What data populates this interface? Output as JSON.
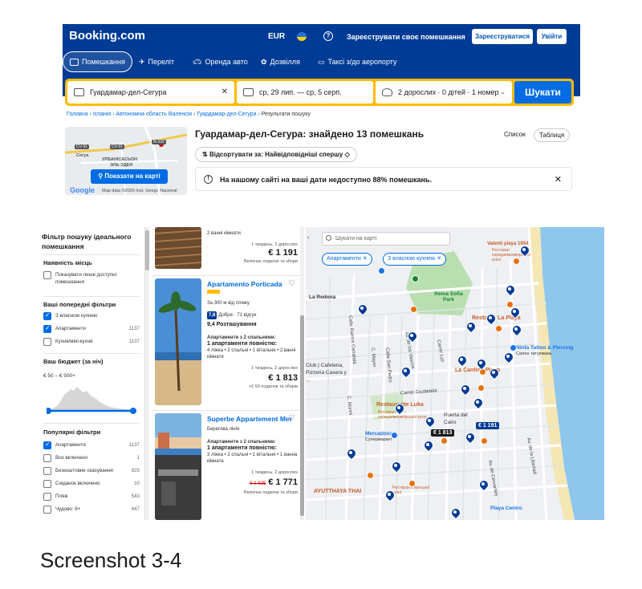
{
  "header": {
    "logo": "Booking.com",
    "currency": "EUR",
    "list_property": "Зареєструвати своє помешкання",
    "register": "Зареєструватися",
    "signin": "Увійти",
    "nav": [
      "Помешкання",
      "Переліт",
      "Оренда авто",
      "Дозвілля",
      "Таксі з/до аеропорту"
    ]
  },
  "search": {
    "destination": "Гуардамар-дел-Сегура",
    "dates": "ср, 29 лип. — ср, 5 серп.",
    "guests": "2 дорослих · 0 дітей · 1 номер",
    "submit": "Шукати"
  },
  "breadcrumb": [
    "Головна",
    "Іспанія",
    "Автономна область Валенсія",
    "Гуардамар-дел-Сегура",
    "Результати пошуку"
  ],
  "minimap": {
    "show_map": "Показати на карті",
    "google": "Google",
    "credit": "Map data ©2026 Inst. Geogr. Nacional",
    "labels": [
      "Cerya",
      "УРБАНІСАСЬОН",
      "ЭЛЬ ЭДЕН"
    ],
    "badges": [
      "CV-91",
      "CV-91",
      "N-332"
    ]
  },
  "results": {
    "title": "Гуардамар-дел-Сегура: знайдено 13 помешкань",
    "sort": "Відсортувати за: Найвідповідніші спершу",
    "view_list": "Список",
    "view_table": "Таблиця",
    "notice": "На нашому сайті на ваші дати недоступно 88% помешкань."
  },
  "filters": {
    "heading": "Фільтр пошуку ідеального помешкання",
    "availability_title": "Наявність місць",
    "availability_item": "Показувати лише доступні помешкання",
    "previous_title": "Ваші попередні фільтри",
    "previous": [
      {
        "label": "З власною кухнею",
        "count": "",
        "checked": true
      },
      {
        "label": "Апартаменти",
        "count": "1137",
        "checked": true
      },
      {
        "label": "Кухня/міні-кухня",
        "count": "1137",
        "checked": false
      }
    ],
    "budget_title": "Ваш бюджет (за ніч)",
    "budget_range": "€ 50 – € 500+",
    "popular_title": "Популярні фільтри",
    "popular": [
      {
        "label": "Апартаменти",
        "count": "1137",
        "checked": true
      },
      {
        "label": "Все включено",
        "count": "1",
        "checked": false
      },
      {
        "label": "Безкоштовне скасування",
        "count": "925",
        "checked": false
      },
      {
        "label": "Сніданок включено",
        "count": "10",
        "checked": false
      },
      {
        "label": "Пляж",
        "count": "543",
        "checked": false
      },
      {
        "label": "Чудово: 9+",
        "count": "447",
        "checked": false
      }
    ]
  },
  "cards": [
    {
      "lines": [
        "2 ванні кімнати"
      ],
      "duration": "1 тиждень, 2 дорослих",
      "price": "€ 1 191",
      "tax": "Включає податки та збори"
    },
    {
      "name": "Apartamento Porticada",
      "distance": "За 300 м від пляжу",
      "score": "7,8",
      "score_text": "Добре · 71 відгук",
      "location": "9,4 Розташування",
      "unit_title": "Апартаменти з 2 спальнями:",
      "unit_full": "1 апартаменти повністю:",
      "beds": "4 ліжка • 2 спальні • 1 вітальня • 2 ванні кімнати",
      "duration": "1 тиждень, 2 дорослих",
      "price": "€ 1 813",
      "tax": "+€ 50 податків та зборів"
    },
    {
      "name": "Superbe Appartement Mer",
      "location": "Берегова лінія",
      "unit_title": "Апартаменти з 2 спальнями:",
      "unit_full": "1 апартаменти повністю:",
      "beds": "3 ліжка • 2 спальні • 1 вітальня • 1 ванна кімната",
      "duration": "1 тиждень, 2 дорослих",
      "old_price": "€ 1 925",
      "price": "€ 1 771",
      "tax": "Включає податки та збори"
    }
  ],
  "map": {
    "search_placeholder": "Шукати на карті",
    "chips": [
      "Апартаменти",
      "З власною кухнею"
    ],
    "price_tags": [
      "€ 1 813",
      "€ 1 191"
    ],
    "places": {
      "valenti": "Valenti playa 1954",
      "valenti_sub": "Ресторан середземноморської кухні",
      "reina": "Reina Sofia Park",
      "redona": "La Redona",
      "playa": "Restobar La Playa",
      "ninfa": "Ninfa Tattoo & Piercing",
      "ninfa_sub": "Салон татуювань",
      "cafeteria": "Club | Cafeteria, Pizzeria Casera y ...",
      "cantina": "La Cantina Playa",
      "luka": "Restaurante Luka",
      "luka_sub": "Ресторан середземноморської кухні",
      "puerta": "Puerta del Cairo",
      "mercadona": "Mercadona",
      "mercadona_sub": "Супермаркет",
      "ayutthaya": "AYUTTHAYA THAI",
      "rest_sub": "Ресторан іспанської кухні",
      "playa_centro": "Playa Centro"
    },
    "streets": [
      "Calle Ramos Carratalá",
      "C. Mayor",
      "Av. de los Vascos",
      "Carrer Luz",
      "Calle San Pedro",
      "Carrer Ciudadela",
      "Av. de la Libertad",
      "Av. de Cervantes",
      "C. Moreti"
    ]
  },
  "caption": "Screenshot 3-4",
  "colors": {
    "brand_blue": "#003b95",
    "accent_blue": "#006ce4",
    "search_yellow": "#febb02"
  }
}
